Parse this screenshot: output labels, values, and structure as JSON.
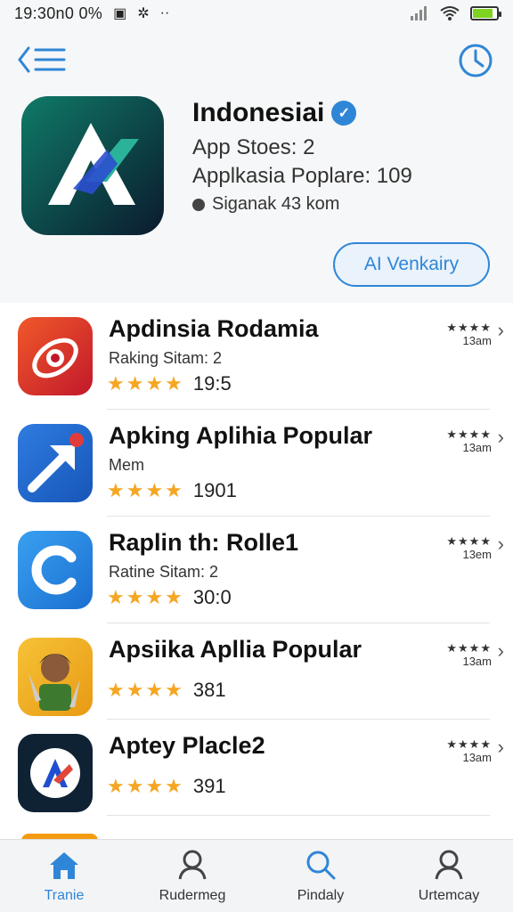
{
  "status": {
    "time": "19:30n0 0%",
    "icons": [
      "notification-icon",
      "bug-icon",
      "more-dots-icon",
      "signal-icon",
      "wifi-icon",
      "battery-icon"
    ]
  },
  "header": {
    "title": "Indonesiai",
    "stores": "App Stoes: 2",
    "popular": "Applkasia Poplare: 109",
    "location": "Siganak 43 kom",
    "verify_button": "AI Venkairy",
    "accent": "#2f86d6"
  },
  "apps": [
    {
      "name": "Apdinsia Rodamia",
      "sub": "Raking Sitam: 2",
      "rating": "19:5",
      "mini_stars": "★★★★",
      "mini_count": "13am",
      "icon": "orange-app-icon"
    },
    {
      "name": "Apking Aplihia Popular",
      "sub": "Mem",
      "rating": "1901",
      "mini_stars": "★★★★",
      "mini_count": "13am",
      "icon": "arrow-app-icon"
    },
    {
      "name": "Raplin th: Rolle1",
      "sub": "Ratine Sitam: 2",
      "rating": "30:0",
      "mini_stars": "★★★★",
      "mini_count": "13em",
      "icon": "c-app-icon"
    },
    {
      "name": "Apsiika Apllia Popular",
      "sub": "",
      "rating": "381",
      "mini_stars": "★★★★",
      "mini_count": "13am",
      "icon": "character-app-icon"
    },
    {
      "name": "Aptey Placle2",
      "sub": "",
      "rating": "391",
      "mini_stars": "★★★★",
      "mini_count": "13am",
      "icon": "dark-a-app-icon"
    }
  ],
  "stars_text": "★★★★",
  "tabs": [
    {
      "label": "Tranie",
      "icon": "home-icon"
    },
    {
      "label": "Rudermeg",
      "icon": "user-icon"
    },
    {
      "label": "Pindaly",
      "icon": "search-icon"
    },
    {
      "label": "Urtemcay",
      "icon": "person-icon"
    }
  ]
}
